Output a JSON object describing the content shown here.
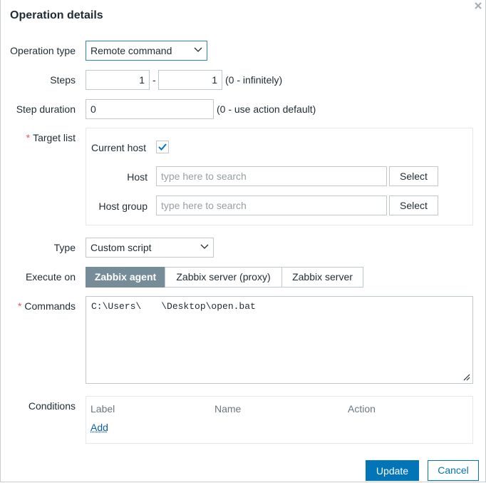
{
  "dialog": {
    "title": "Operation details"
  },
  "operation_type": {
    "label": "Operation type",
    "value": "Remote command"
  },
  "steps": {
    "label": "Steps",
    "from": "1",
    "separator": "-",
    "to": "1",
    "hint": "(0 - infinitely)"
  },
  "step_duration": {
    "label": "Step duration",
    "value": "0",
    "hint": "(0 - use action default)"
  },
  "target_list": {
    "label": "Target list",
    "required_mark": "*",
    "current_host_label": "Current host",
    "current_host_checked": true,
    "host": {
      "label": "Host",
      "placeholder": "type here to search",
      "button": "Select"
    },
    "host_group": {
      "label": "Host group",
      "placeholder": "type here to search",
      "button": "Select"
    }
  },
  "type": {
    "label": "Type",
    "value": "Custom script"
  },
  "execute_on": {
    "label": "Execute on",
    "options": [
      "Zabbix agent",
      "Zabbix server (proxy)",
      "Zabbix server"
    ],
    "selected": "Zabbix agent"
  },
  "commands": {
    "label": "Commands",
    "required_mark": "*",
    "part1": "C:\\Users\\",
    "part2": "\\Desktop\\open.bat"
  },
  "conditions": {
    "label": "Conditions",
    "columns": [
      "Label",
      "Name",
      "Action"
    ],
    "add_link": "Add"
  },
  "footer": {
    "update": "Update",
    "cancel": "Cancel"
  },
  "colors": {
    "primary": "#0275b8",
    "segment_active": "#768d99",
    "required": "#e45959"
  }
}
